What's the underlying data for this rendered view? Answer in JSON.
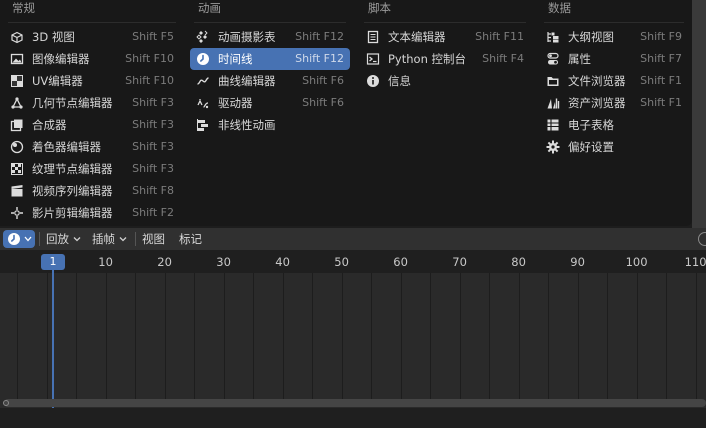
{
  "menu": {
    "columns": [
      {
        "header": "常规",
        "items": [
          {
            "label": "3D 视图",
            "shortcut": "Shift F5",
            "icon": "view3d-icon"
          },
          {
            "label": "图像编辑器",
            "shortcut": "Shift F10",
            "icon": "image-editor-icon"
          },
          {
            "label": "UV编辑器",
            "shortcut": "Shift F10",
            "icon": "uv-editor-icon"
          },
          {
            "label": "几何节点编辑器",
            "shortcut": "Shift F3",
            "icon": "geometry-nodes-icon"
          },
          {
            "label": "合成器",
            "shortcut": "Shift F3",
            "icon": "compositor-icon"
          },
          {
            "label": "着色器编辑器",
            "shortcut": "Shift F3",
            "icon": "shader-editor-icon"
          },
          {
            "label": "纹理节点编辑器",
            "shortcut": "Shift F3",
            "icon": "texture-nodes-icon"
          },
          {
            "label": "视频序列编辑器",
            "shortcut": "Shift F8",
            "icon": "sequencer-icon"
          },
          {
            "label": "影片剪辑编辑器",
            "shortcut": "Shift F2",
            "icon": "clip-editor-icon"
          }
        ]
      },
      {
        "header": "动画",
        "items": [
          {
            "label": "动画摄影表",
            "shortcut": "Shift F12",
            "icon": "dopesheet-icon"
          },
          {
            "label": "时间线",
            "shortcut": "Shift F12",
            "icon": "timeline-icon",
            "active": true
          },
          {
            "label": "曲线编辑器",
            "shortcut": "Shift F6",
            "icon": "graph-editor-icon"
          },
          {
            "label": "驱动器",
            "shortcut": "Shift F6",
            "icon": "drivers-icon"
          },
          {
            "label": "非线性动画",
            "shortcut": "",
            "icon": "nla-icon"
          }
        ]
      },
      {
        "header": "脚本",
        "items": [
          {
            "label": "文本编辑器",
            "shortcut": "Shift F11",
            "icon": "text-editor-icon"
          },
          {
            "label": "Python 控制台",
            "shortcut": "Shift F4",
            "icon": "python-console-icon"
          },
          {
            "label": "信息",
            "shortcut": "",
            "icon": "info-icon"
          }
        ]
      },
      {
        "header": "数据",
        "items": [
          {
            "label": "大纲视图",
            "shortcut": "Shift F9",
            "icon": "outliner-icon"
          },
          {
            "label": "属性",
            "shortcut": "Shift F7",
            "icon": "properties-icon"
          },
          {
            "label": "文件浏览器",
            "shortcut": "Shift F1",
            "icon": "file-browser-icon"
          },
          {
            "label": "资产浏览器",
            "shortcut": "Shift F1",
            "icon": "asset-browser-icon"
          },
          {
            "label": "电子表格",
            "shortcut": "",
            "icon": "spreadsheet-icon"
          },
          {
            "label": "偏好设置",
            "shortcut": "",
            "icon": "preferences-icon"
          }
        ]
      }
    ]
  },
  "header": {
    "menus": [
      "回放",
      "插帧",
      "视图",
      "标记"
    ],
    "editor_icon": "timeline-icon"
  },
  "timeline": {
    "current_frame": "1",
    "ruler_labels": [
      "10",
      "20",
      "30",
      "40",
      "50",
      "60",
      "70",
      "80",
      "90",
      "100",
      "110"
    ]
  },
  "colors": {
    "accent": "#4772b3",
    "menu_bg": "#181818",
    "header_bg": "#303030",
    "timeline_bg": "#2a2a2a"
  }
}
